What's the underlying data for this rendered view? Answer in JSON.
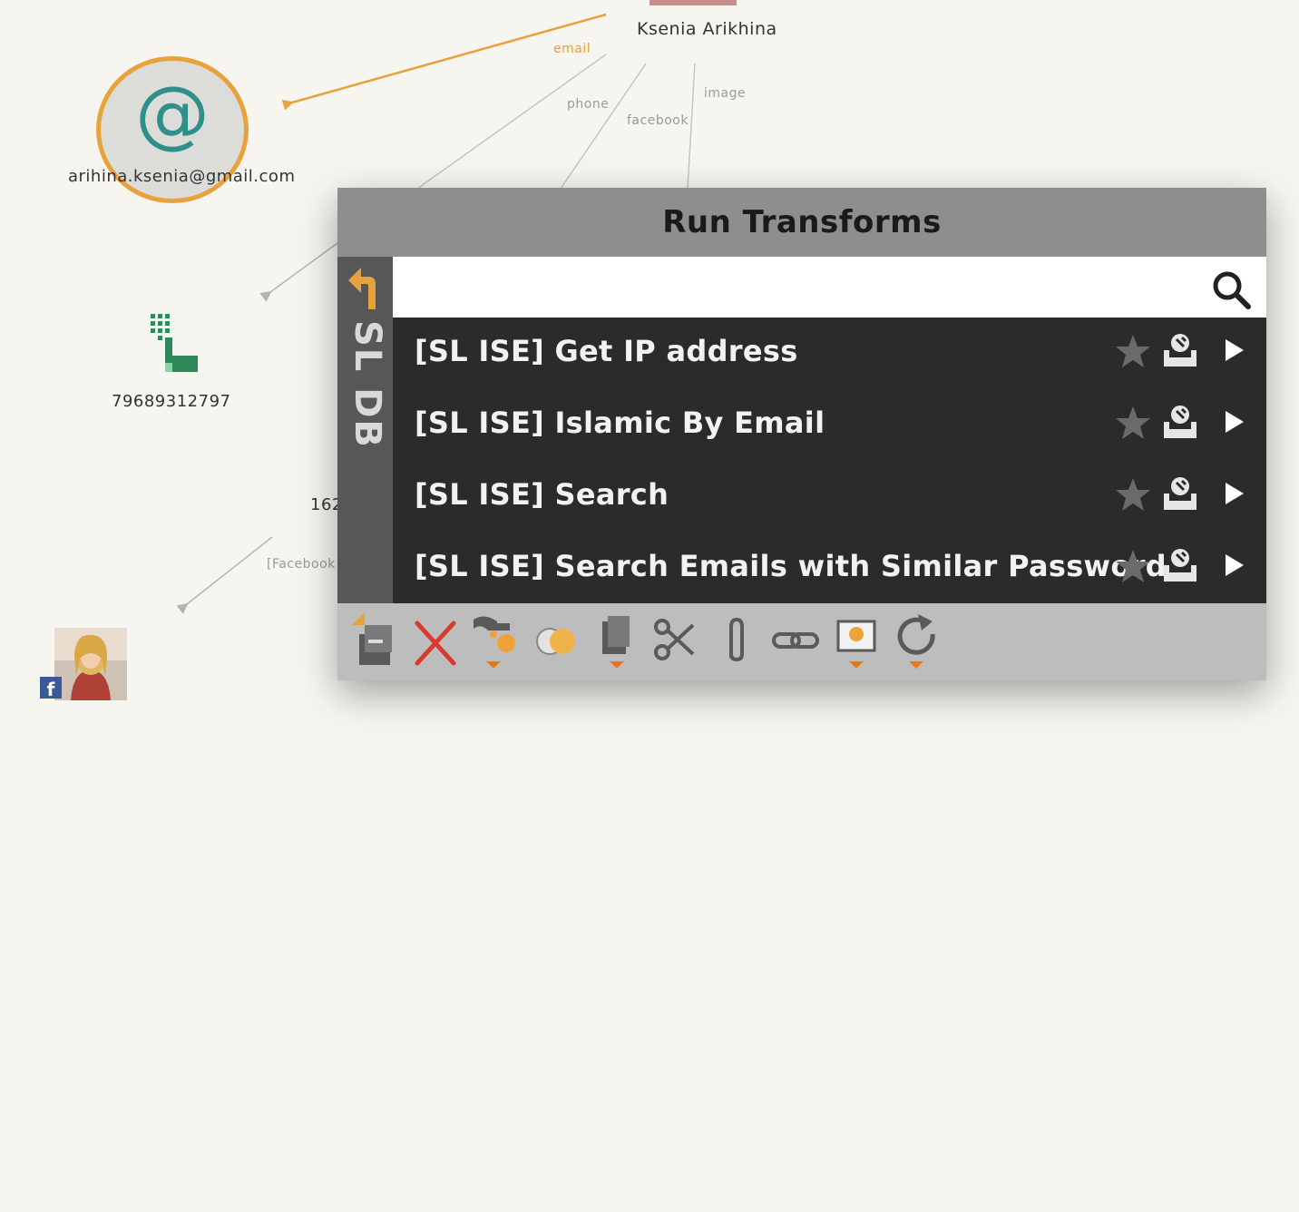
{
  "graph": {
    "person_name": "Ksenia Arikhina",
    "edge_labels": {
      "email": "email",
      "phone": "phone",
      "facebook": "facebook",
      "image": "image",
      "facebook_bracket": "[Facebook"
    },
    "email_node": {
      "icon": "at-icon",
      "label": "arihina.ksenia@gmail.com"
    },
    "phone_node": {
      "icon": "phone-icon",
      "label": "79689312797"
    },
    "partial_node_label": "162",
    "photo_node": {
      "icon": "facebook-icon"
    }
  },
  "dialog": {
    "title": "Run Transforms",
    "side_tab": {
      "label": "SL DB",
      "icon": "back-arrow-icon"
    },
    "search": {
      "value": "",
      "placeholder": "",
      "icon": "search-icon"
    },
    "transforms": [
      {
        "label": "[SL ISE] Get IP address"
      },
      {
        "label": "[SL ISE] Islamic By Email"
      },
      {
        "label": "[SL ISE] Search"
      },
      {
        "label": "[SL ISE] Search Emails with Similar Password"
      }
    ],
    "toolbar": [
      "copy-to-new-graph-icon",
      "delete-icon",
      "change-type-icon",
      "merge-icon",
      "paste-icon",
      "cut-icon",
      "attach-icon",
      "link-icon",
      "select-icon",
      "refresh-icon"
    ]
  },
  "colors": {
    "accent": "#e8a23c",
    "teal": "#2f8f8a",
    "green": "#2f8a5b",
    "list_bg": "#2c2a2a",
    "title_bar": "#8e8e8e",
    "toolbar_bg": "#bdbdbd"
  }
}
